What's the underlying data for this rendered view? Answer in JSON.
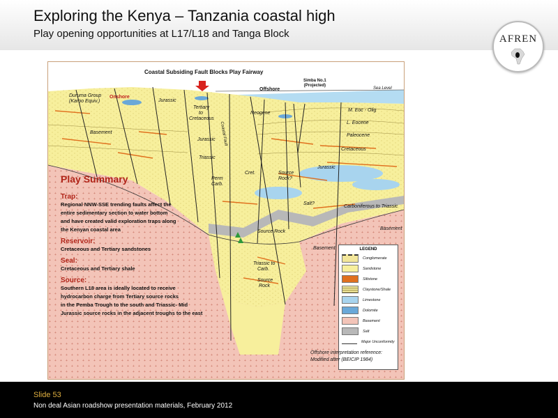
{
  "header": {
    "title": "Exploring the Kenya – Tanzania coastal high",
    "subtitle": "Play opening opportunities at L17/L18 and Tanga Block"
  },
  "logo": {
    "text": "AFREN",
    "icon": "africa-map-icon"
  },
  "diagram": {
    "fairway_label": "Coastal Subsiding Fault Blocks Play Fairway",
    "onshore_label": "Onshore",
    "offshore_label": "Offshore",
    "well_label_line1": "Simba No.1",
    "well_label_line2": "(Projected)",
    "sea_level_label": "Sea Level",
    "formation_labels": {
      "duruma": "Duruma Group",
      "karoo": "(Karoo Equiv.)",
      "jurassic_onshore": "Jurassic",
      "tertiary": "Tertiary",
      "to": "to",
      "cretaceous_onshore": "Cretaceous",
      "jurassic_mid": "Jurassic",
      "triassic": "Triassic",
      "perm_carb": "Perm",
      "perm_carb2": "Carb.",
      "basement_left": "Basement",
      "neogene": "Neogene",
      "cret": "Cret.",
      "source_rock_q": "Source",
      "source_rock_q2": "Rock?",
      "salt_q": "Salt?",
      "source_rock_low": "Source Rock",
      "jurassic_right": "Jurassic",
      "cretaceous_right": "Cretaceous",
      "paleocene": "Paleocene",
      "l_eocene": "L. Eocene",
      "m_eoc_olig": "M. Eoc - Olig",
      "carb_triassic": "Carboniferous to Triassic",
      "basement_mid": "Basement",
      "basement_right": "Basement",
      "triassic_carb": "Triassic to",
      "triassic_carb2": "Carb.",
      "source_rock_bottom": "Source",
      "source_rock_bottom2": "Rock",
      "fault_name": "Coastal Fault"
    },
    "play_summary": {
      "title": "Play Summary",
      "sections": [
        {
          "heading": "Trap:",
          "lines": [
            "Regional NNW-SSE trending faults affect  the",
            "entire sedimentary section to water bottom",
            "and have created  valid exploration traps  along",
            "the Kenyan coastal  area"
          ]
        },
        {
          "heading": "Reservoir:",
          "lines": [
            "Cretaceous  and Tertiary sandstones"
          ]
        },
        {
          "heading": "Seal:",
          "lines": [
            "Cretaceous  and Tertiary shale"
          ]
        },
        {
          "heading": "Source:",
          "lines": [
            "Southern L18  area is ideally located to receive",
            "hydrocarbon charge  from  Tertiary source rocks",
            "in the Pemba Trough to the south and  Triassic- Mid",
            "Jurassic source rocks  in the adjacent troughs to the east"
          ]
        }
      ]
    },
    "legend": {
      "title": "LEGEND",
      "items": [
        {
          "label": "Conglomerate",
          "color": "#f2e69a"
        },
        {
          "label": "Sandstone",
          "color": "#f7ef9c"
        },
        {
          "label": "Siltstone",
          "color": "#e0701e"
        },
        {
          "label": "Claystone/Shale",
          "color": "#f4eca0"
        },
        {
          "label": "Limestone",
          "color": "#a8d4ee"
        },
        {
          "label": "Dolomite",
          "color": "#6aa8d8"
        },
        {
          "label": "Basement",
          "color": "#f3c4b8"
        },
        {
          "label": "Salt",
          "color": "#b8b8b8"
        },
        {
          "label": "Major Unconformity",
          "color": "#ffffff"
        }
      ]
    },
    "reference_line1": "Offshore interpretation reference:",
    "reference_line2": "Modified after (BEICIP 1984)"
  },
  "footer": {
    "slide_number": "Slide 53",
    "caption": "Non deal Asian roadshow presentation materials, February 2012"
  },
  "colors": {
    "accent_red": "#b02418",
    "footer_bg": "#000000",
    "slide_no": "#e0b040",
    "sea": "#b4dcf2",
    "sand": "#f7ef9c",
    "basement": "#f3c4b8",
    "salt": "#b8b8b8"
  }
}
